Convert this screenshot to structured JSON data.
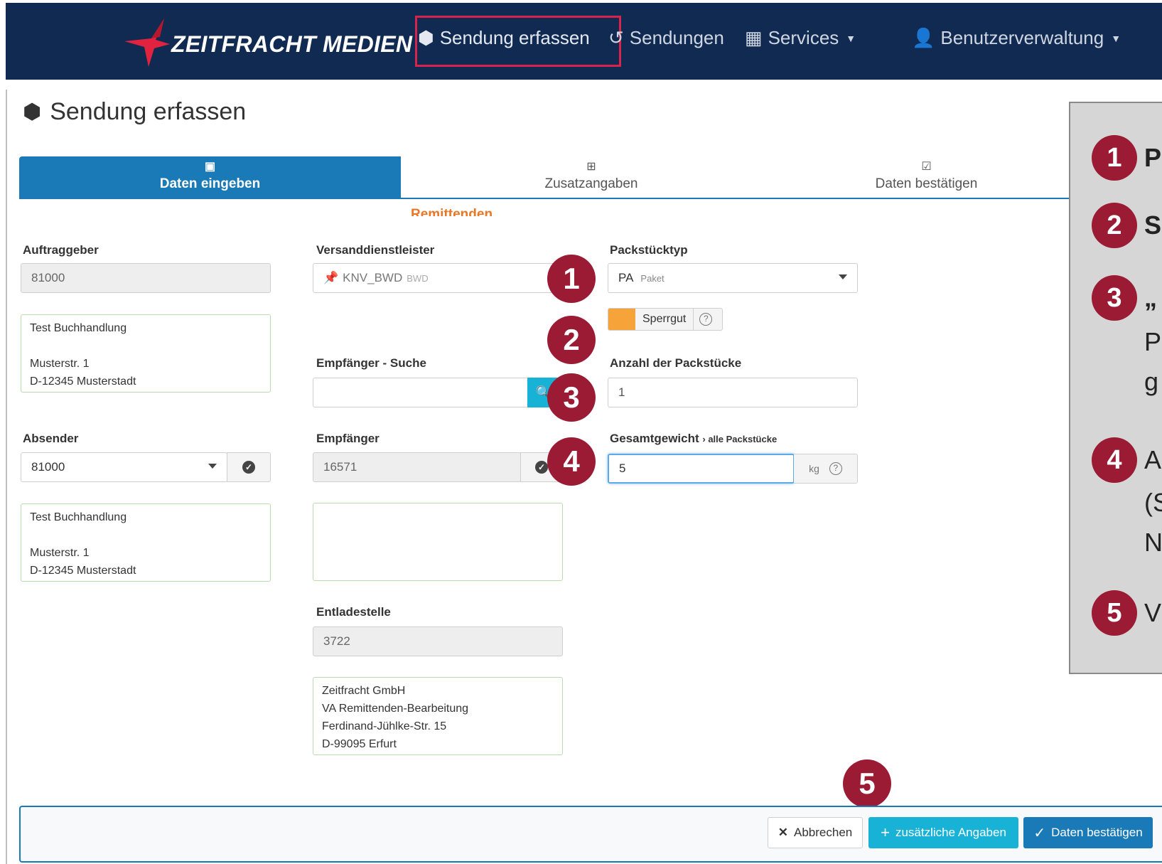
{
  "navbar": {
    "brand": "ZEITFRACHT MEDIEN",
    "items": [
      {
        "label": "Sendung erfassen",
        "icon": "cube-icon"
      },
      {
        "label": "Sendungen",
        "icon": "history-icon"
      },
      {
        "label": "Services",
        "icon": "grid-icon"
      },
      {
        "label": "Benutzerverwaltung",
        "icon": "user-icon"
      }
    ]
  },
  "page": {
    "title": "Sendung erfassen"
  },
  "steps": [
    {
      "label": "Daten eingeben",
      "icon": "address-book-icon",
      "active": true
    },
    {
      "label": "Zusatzangaben",
      "icon": "plus-square-icon",
      "active": false
    },
    {
      "label": "Daten bestätigen",
      "icon": "check-square-icon",
      "active": false
    }
  ],
  "remittenden": "Remittenden",
  "auftraggeber": {
    "label": "Auftraggeber",
    "value": "81000",
    "address": [
      "Test Buchhandlung",
      "",
      "Musterstr. 1",
      "D-12345 Musterstadt"
    ]
  },
  "absender": {
    "label": "Absender",
    "value": "81000",
    "address": [
      "Test Buchhandlung",
      "",
      "Musterstr. 1",
      "D-12345 Musterstadt"
    ]
  },
  "versanddienstleister": {
    "label": "Versanddienstleister",
    "value": "KNV_BWD",
    "sub": "BWD"
  },
  "empfaenger_suche": {
    "label": "Empfänger - Suche",
    "value": ""
  },
  "empfaenger": {
    "label": "Empfänger",
    "value": "16571"
  },
  "entladestelle": {
    "label": "Entladestelle",
    "value": "3722",
    "address": [
      "Zeitfracht GmbH",
      "VA Remittenden-Bearbeitung",
      "Ferdinand-Jühlke-Str. 15",
      "D-99095 Erfurt"
    ]
  },
  "packstuecktyp": {
    "label": "Packstücktyp",
    "code": "PA",
    "name": "Paket"
  },
  "sperrgut": {
    "label": "Sperrgut"
  },
  "anzahl": {
    "label": "Anzahl der Packstücke",
    "value": "1"
  },
  "gesamtgewicht": {
    "label": "Gesamtgewicht",
    "sub": "› alle Packstücke",
    "value": "5",
    "unit": "kg"
  },
  "markers": [
    "1",
    "2",
    "3",
    "4",
    "5"
  ],
  "info_panel": [
    {
      "num": "1",
      "text": "P"
    },
    {
      "num": "2",
      "text": "S"
    },
    {
      "num": "3",
      "text": "„",
      "cont": [
        "P",
        "g"
      ]
    },
    {
      "num": "4",
      "text": "A",
      "cont": [
        "(S",
        "N"
      ]
    },
    {
      "num": "5",
      "text": "V"
    }
  ],
  "buttons": {
    "cancel": "Abbrechen",
    "extra": "zusätzliche Angaben",
    "confirm": "Daten bestätigen"
  },
  "colors": {
    "navbar": "#112a52",
    "accent": "#1a7ab8",
    "info": "#17b2d6",
    "marker": "#9a1b33",
    "highlight": "#d6254d",
    "toggle": "#f6a33a"
  }
}
